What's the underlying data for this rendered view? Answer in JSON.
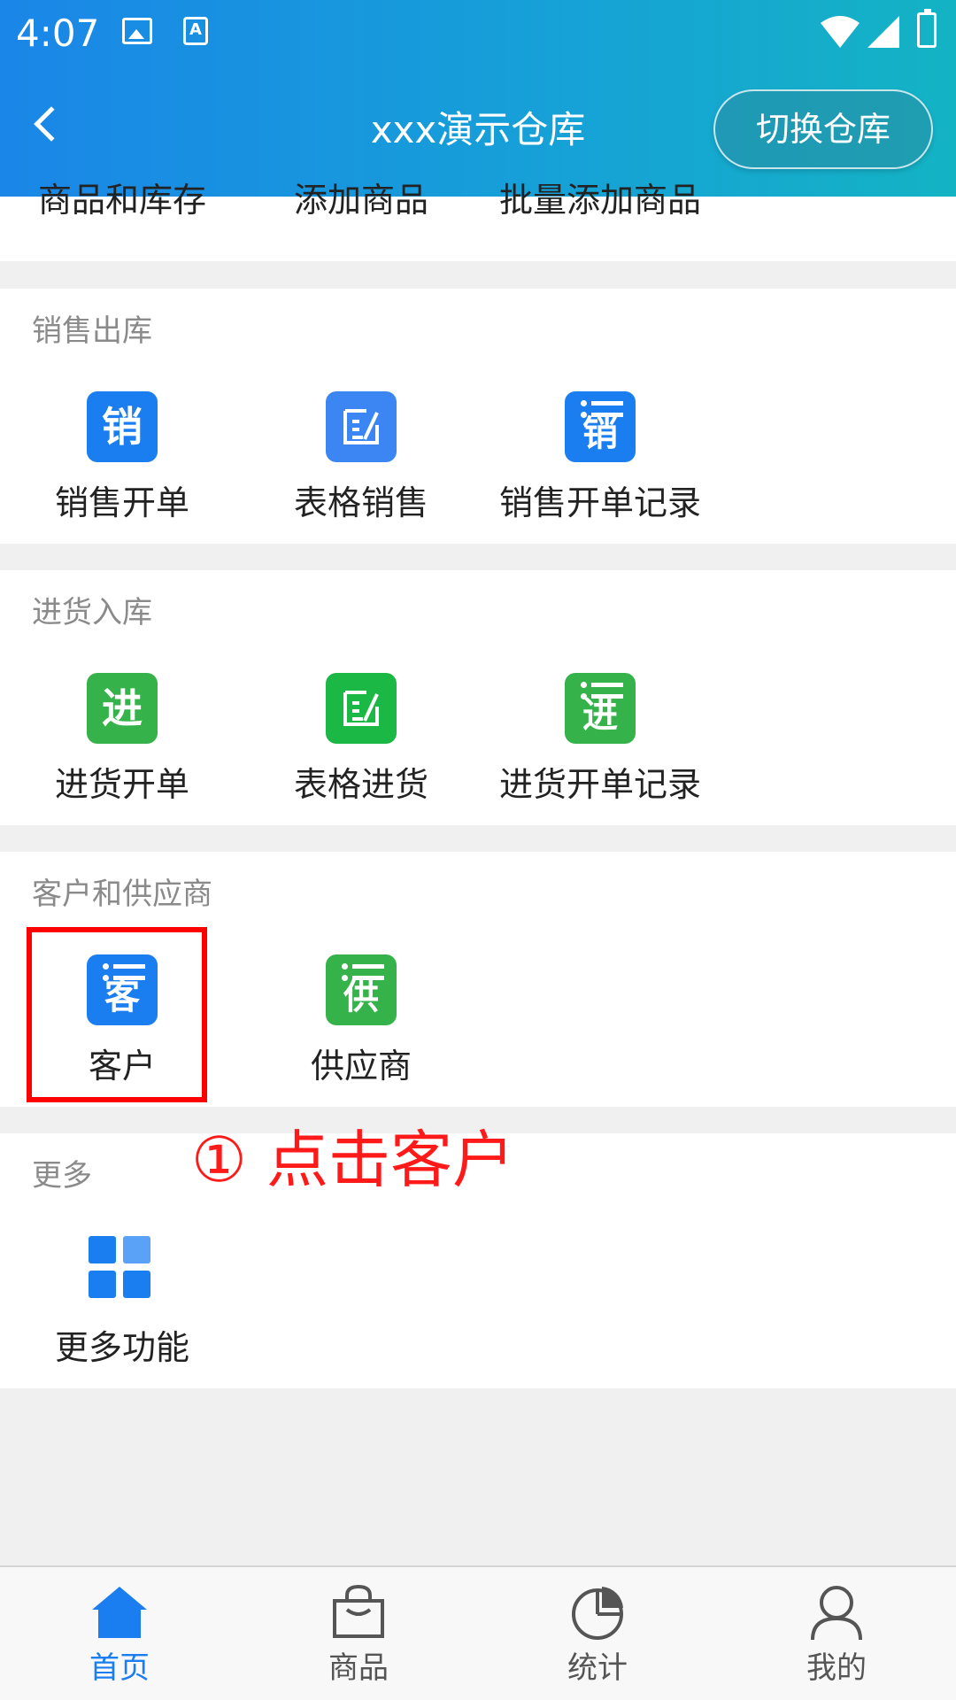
{
  "status_bar": {
    "time": "4:07"
  },
  "header": {
    "title": "xxx演示仓库",
    "switch_label": "切换仓库"
  },
  "sections": {
    "goods": {
      "items": [
        "商品和库存",
        "添加商品",
        "批量添加商品"
      ]
    },
    "sales": {
      "title": "销售出库",
      "items": [
        {
          "label": "销售开单",
          "icon_text": "销",
          "icon": "sales-order-icon"
        },
        {
          "label": "表格销售",
          "icon": "table-edit-icon"
        },
        {
          "label": "销售开单记录",
          "icon_text": "销",
          "icon": "sales-record-icon"
        }
      ]
    },
    "purchase": {
      "title": "进货入库",
      "items": [
        {
          "label": "进货开单",
          "icon_text": "进",
          "icon": "purchase-order-icon"
        },
        {
          "label": "表格进货",
          "icon": "table-edit-icon"
        },
        {
          "label": "进货开单记录",
          "icon_text": "进",
          "icon": "purchase-record-icon"
        }
      ]
    },
    "contacts": {
      "title": "客户和供应商",
      "items": [
        {
          "label": "客户",
          "icon_text": "客",
          "icon": "customer-icon"
        },
        {
          "label": "供应商",
          "icon_text": "供",
          "icon": "supplier-icon"
        }
      ]
    },
    "more": {
      "title": "更多",
      "items": [
        {
          "label": "更多功能",
          "icon": "grid-icon"
        }
      ]
    }
  },
  "annotation": {
    "text": "① 点击客户"
  },
  "bottom_nav": {
    "items": [
      {
        "label": "首页",
        "icon": "home-icon",
        "active": true
      },
      {
        "label": "商品",
        "icon": "shopping-bag-icon",
        "active": false
      },
      {
        "label": "统计",
        "icon": "pie-chart-icon",
        "active": false
      },
      {
        "label": "我的",
        "icon": "user-icon",
        "active": false
      }
    ]
  },
  "colors": {
    "primary": "#1a7ef0",
    "green": "#35b24a",
    "highlight": "#ff0000"
  }
}
